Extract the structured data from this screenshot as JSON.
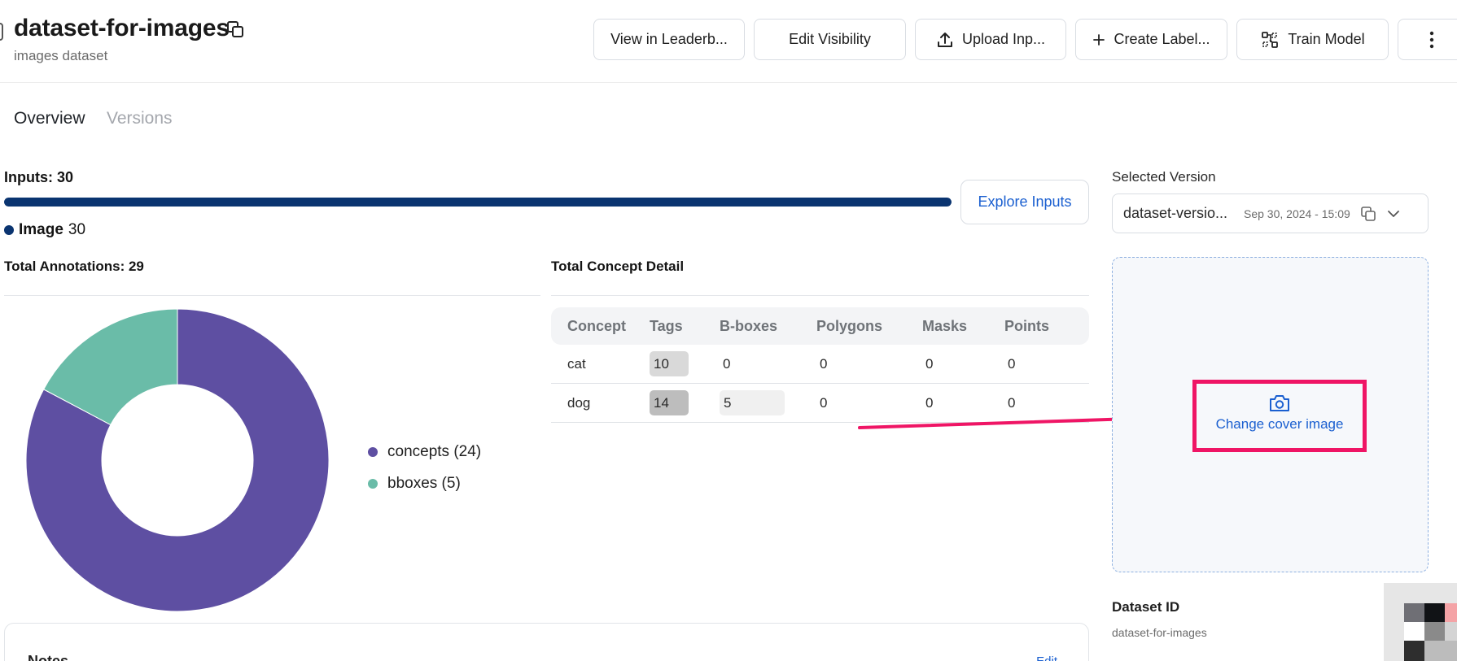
{
  "header": {
    "title": "dataset-for-images",
    "subtitle": "images dataset",
    "buttons": {
      "leaderboard": "View in Leaderb...",
      "visibility": "Edit Visibility",
      "upload": "Upload Inp...",
      "labels": "Create Label...",
      "train": "Train Model"
    }
  },
  "tabs": {
    "overview": "Overview",
    "versions": "Versions"
  },
  "inputs": {
    "label": "Inputs: 30",
    "progress_fraction": 1.0,
    "explore": "Explore Inputs",
    "image_name": "Image",
    "image_count": "30"
  },
  "annotations": {
    "title": "Total Annotations: 29",
    "legend": [
      {
        "label": "concepts (24)",
        "value": 24,
        "color": "#5e4fa2"
      },
      {
        "label": "bboxes (5)",
        "value": 5,
        "color": "#6abca8"
      }
    ]
  },
  "concepts": {
    "title": "Total Concept Detail",
    "headers": [
      "Concept",
      "Tags",
      "B-boxes",
      "Polygons",
      "Masks",
      "Points"
    ],
    "rows": [
      {
        "concept": "cat",
        "tags": "10",
        "bboxes": "0",
        "polygons": "0",
        "masks": "0",
        "points": "0"
      },
      {
        "concept": "dog",
        "tags": "14",
        "bboxes": "5",
        "polygons": "0",
        "masks": "0",
        "points": "0"
      }
    ]
  },
  "right_panel": {
    "selected_label": "Selected Version",
    "version_name": "dataset-versio...",
    "version_date": "Sep 30, 2024 - 15:09",
    "cover_text": "Change cover image",
    "dataset_id_label": "Dataset ID",
    "dataset_id_value": "dataset-for-images"
  },
  "notes": {
    "label": "Notes",
    "edit": "Edit"
  },
  "colors": {
    "accent": "#1a5fd0",
    "progress": "#0a3470",
    "highlight": "#ef1565"
  }
}
